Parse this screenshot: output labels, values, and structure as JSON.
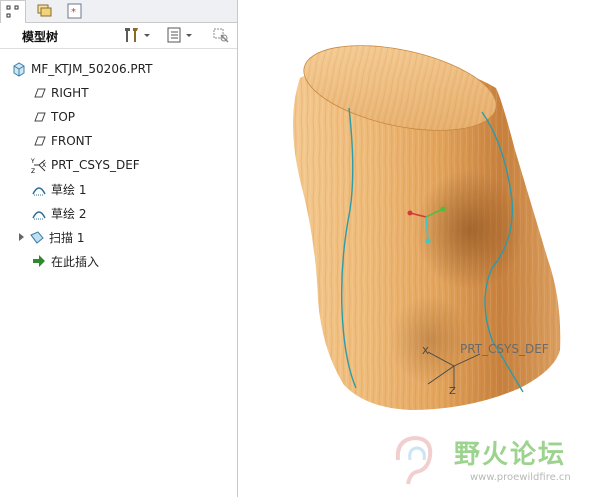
{
  "panel": {
    "title": "模型树",
    "tabs": [
      "model-tree-tab",
      "layers-tab",
      "favorites-tab"
    ]
  },
  "tree": {
    "items": [
      {
        "label": "MF_KTJM_50206.PRT",
        "icon": "part-icon"
      },
      {
        "label": "RIGHT",
        "icon": "datum-plane-icon"
      },
      {
        "label": "TOP",
        "icon": "datum-plane-icon"
      },
      {
        "label": "FRONT",
        "icon": "datum-plane-icon"
      },
      {
        "label": "PRT_CSYS_DEF",
        "icon": "coordinate-system-icon"
      },
      {
        "label": "草绘 1",
        "icon": "sketch-icon"
      },
      {
        "label": "草绘 2",
        "icon": "sketch-icon"
      },
      {
        "label": "扫描 1",
        "icon": "sweep-icon"
      },
      {
        "label": "在此插入",
        "icon": "insert-here-arrow-icon"
      }
    ]
  },
  "viewport": {
    "csys_label": "PRT_CSYS_DEF",
    "axis_x": "X",
    "axis_z": "Z"
  },
  "watermark": {
    "brand": "野火论坛",
    "url": "www.proewildfire.cn"
  },
  "colors": {
    "wood_light": "#f3c489",
    "wood_mid": "#dd9c52",
    "wood_dark": "#a3602a",
    "edge_curve": "#2f9aa8",
    "watermark_green": "#7cc56a"
  }
}
